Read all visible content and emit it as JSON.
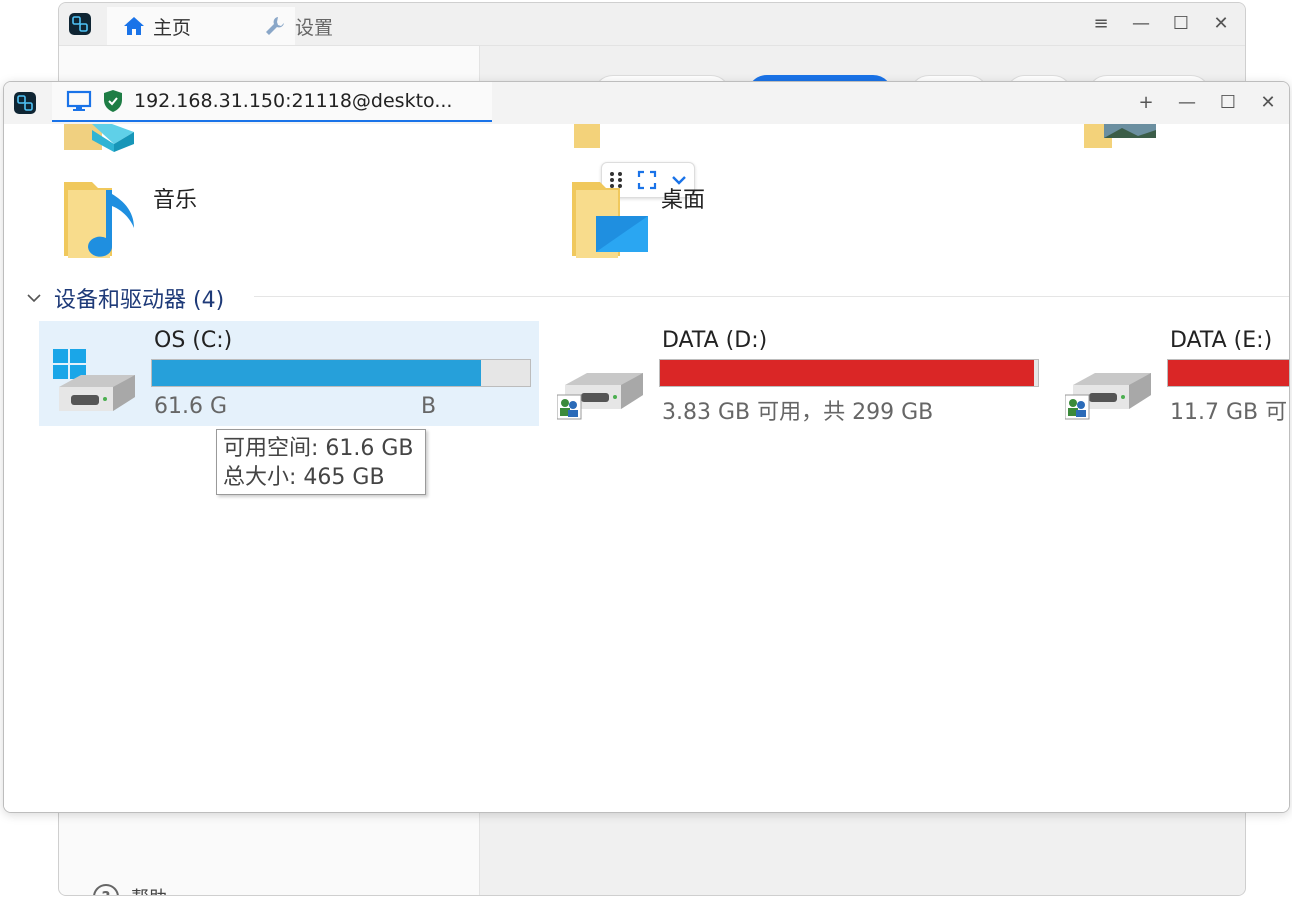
{
  "background_app": {
    "tabs": [
      {
        "label": "主页",
        "icon": "home-icon"
      },
      {
        "label": "设置",
        "icon": "wrench-icon"
      }
    ],
    "window_controls": [
      "≡",
      "—",
      "☐",
      "✕"
    ],
    "help_label": "帮助"
  },
  "remote_window": {
    "tab_title": "192.168.31.150:21118@deskto...",
    "window_controls": [
      "+",
      "—",
      "☐",
      "✕"
    ]
  },
  "explorer": {
    "folders": [
      {
        "label": "音乐",
        "icon": "music-folder-icon"
      },
      {
        "label": "桌面",
        "icon": "desktop-folder-icon"
      }
    ],
    "section_title": "设备和驱动器 (4)",
    "drives": [
      {
        "name": "OS (C:)",
        "used_fraction": 0.87,
        "bar_color": "#26a0da",
        "subtitle": "61.6 GB 可用，共 465 GB",
        "subtitle_visible": "61.6 G",
        "subtitle_tail": "B"
      },
      {
        "name": "DATA (D:)",
        "used_fraction": 0.99,
        "bar_color": "#da2626",
        "subtitle": "3.83 GB 可用，共 299 GB"
      },
      {
        "name": "DATA (E:)",
        "used_fraction": 0.96,
        "bar_color": "#da2626",
        "subtitle": "11.7 GB 可"
      }
    ],
    "tooltip": {
      "line1": "可用空间: 61.6 GB",
      "line2": "总大小: 465 GB"
    }
  },
  "colors": {
    "accent": "#1a73e8",
    "shield": "#1e7d45",
    "section_title": "#1e3a78"
  }
}
